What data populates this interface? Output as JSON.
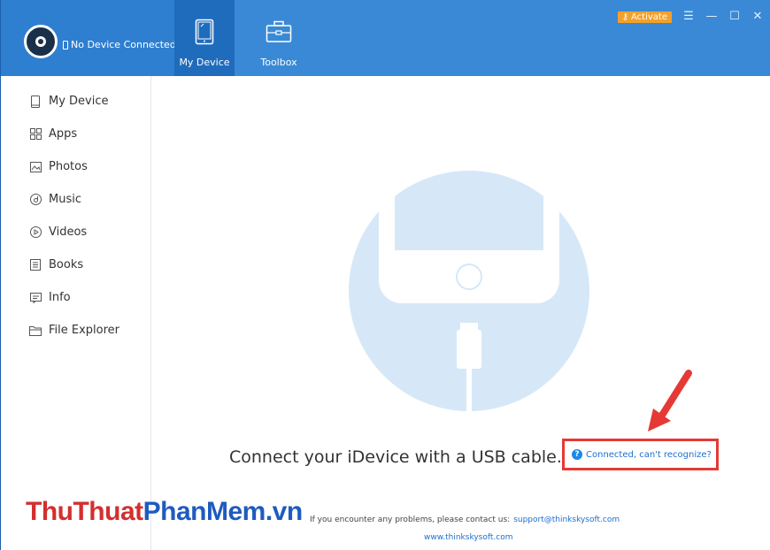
{
  "titlebar": {
    "device_status": "No Device Connected",
    "nav": [
      {
        "label": "My Device",
        "icon": "tablet-icon",
        "active": true
      },
      {
        "label": "Toolbox",
        "icon": "toolbox-icon",
        "active": false
      }
    ],
    "activate_label": "Activate",
    "controls": {
      "menu": "☰",
      "minimize": "—",
      "maximize": "☐",
      "close": "✕"
    },
    "colors": {
      "bar": "#3a89d6",
      "active_tab": "#1f6cbd",
      "activate": "#f3a12b"
    }
  },
  "sidebar": {
    "items": [
      {
        "label": "My Device",
        "icon": "device-icon"
      },
      {
        "label": "Apps",
        "icon": "apps-icon"
      },
      {
        "label": "Photos",
        "icon": "photos-icon"
      },
      {
        "label": "Music",
        "icon": "music-icon"
      },
      {
        "label": "Videos",
        "icon": "videos-icon"
      },
      {
        "label": "Books",
        "icon": "books-icon"
      },
      {
        "label": "Info",
        "icon": "info-icon"
      },
      {
        "label": "File Explorer",
        "icon": "folder-icon"
      }
    ]
  },
  "main": {
    "connect_message": "Connect your iDevice with a USB cable.",
    "help_link": "Connected, can't recognize?",
    "colors": {
      "illustration": "#d6e8f8",
      "highlight_box": "#e53935",
      "link": "#1e6fd0"
    }
  },
  "footer": {
    "watermark_part1": "ThuThuat",
    "watermark_part2": "PhanMem.vn",
    "contact_text": "If you encounter any problems, please contact us:",
    "contact_email": "support@thinkskysoft.com",
    "website": "www.thinkskysoft.com"
  }
}
